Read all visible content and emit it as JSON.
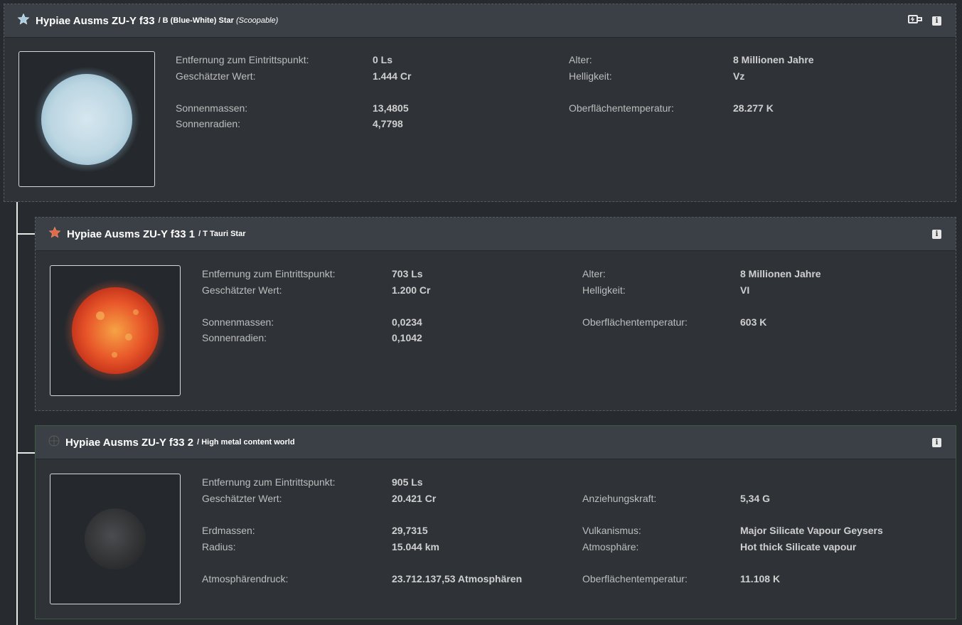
{
  "bodies": [
    {
      "name": "Hypiae Ausms ZU-Y f33",
      "type": "/ B (Blue-White) Star",
      "flag": "(Scoopable)",
      "icon": "star-icon",
      "icon_color": "#a9cde0",
      "fields": [
        {
          "label": "Entfernung zum Eintrittspunkt:",
          "value": "0 Ls"
        },
        {
          "label": "Geschätzter Wert:",
          "value": "1.444 Cr"
        },
        {
          "label": "Sonnenmassen:",
          "value": "13,4805"
        },
        {
          "label": "Sonnenradien:",
          "value": "4,7798"
        },
        {
          "label": "Alter:",
          "value": "8 Millionen Jahre"
        },
        {
          "label": "Helligkeit:",
          "value": "Vz"
        },
        {
          "label": "Oberflächentemperatur:",
          "value": "28.277 K"
        }
      ]
    },
    {
      "name": "Hypiae Ausms ZU-Y f33 1",
      "type": "/ T Tauri Star",
      "icon": "star-icon",
      "icon_color": "#e06b4a",
      "fields": [
        {
          "label": "Entfernung zum Eintrittspunkt:",
          "value": "703 Ls"
        },
        {
          "label": "Geschätzter Wert:",
          "value": "1.200 Cr"
        },
        {
          "label": "Sonnenmassen:",
          "value": "0,0234"
        },
        {
          "label": "Sonnenradien:",
          "value": "0,1042"
        },
        {
          "label": "Alter:",
          "value": "8 Millionen Jahre"
        },
        {
          "label": "Helligkeit:",
          "value": "VI"
        },
        {
          "label": "Oberflächentemperatur:",
          "value": "603 K"
        }
      ]
    },
    {
      "name": "Hypiae Ausms ZU-Y f33 2",
      "type": "/ High metal content world",
      "icon": "planet-icon",
      "fields": [
        {
          "label": "Entfernung zum Eintrittspunkt:",
          "value": "905 Ls"
        },
        {
          "label": "Geschätzter Wert:",
          "value": "20.421 Cr"
        },
        {
          "label": "Erdmassen:",
          "value": "29,7315"
        },
        {
          "label": "Radius:",
          "value": "15.044 km"
        },
        {
          "label": "Atmosphärendruck:",
          "value": "23.712.137,53 Atmosphären"
        },
        {
          "label": "Anziehungskraft:",
          "value": "5,34 G"
        },
        {
          "label": "Vulkanismus:",
          "value": "Major Silicate Vapour Geysers"
        },
        {
          "label": "Atmosphäre:",
          "value": "Hot thick Silicate vapour"
        },
        {
          "label": "Oberflächentemperatur:",
          "value": "11.108 K"
        }
      ]
    }
  ],
  "icons": {
    "info": "i",
    "landable": "landable-icon"
  }
}
